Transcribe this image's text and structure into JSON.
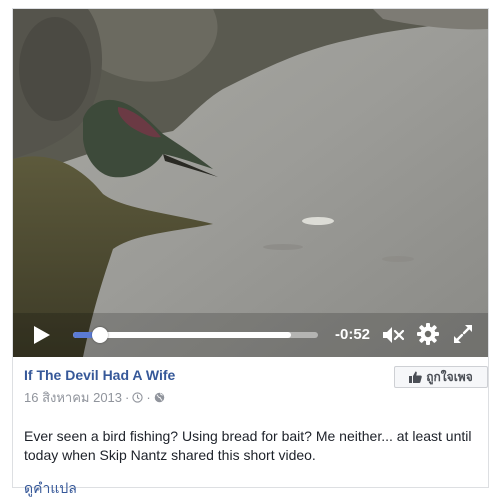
{
  "video": {
    "time_remaining": "-0:52",
    "progress": {
      "played_fraction": 0.11,
      "buffered_fraction": 0.89
    }
  },
  "post": {
    "page_name": "If The Devil Had A Wife",
    "date": "16 สิงหาคม 2013",
    "separator": "·",
    "audience_icon": "globe-icon",
    "like_page_label": "ถูกใจเพจ",
    "text": "Ever seen a bird fishing? Using bread for bait? Me neither... at least until today when Skip Nantz shared this short video.",
    "see_translation": "ดูคำแปล"
  },
  "colors": {
    "link": "#365899",
    "meta": "#90949c",
    "text": "#1d2129",
    "progress_played": "#5b7bd5"
  }
}
